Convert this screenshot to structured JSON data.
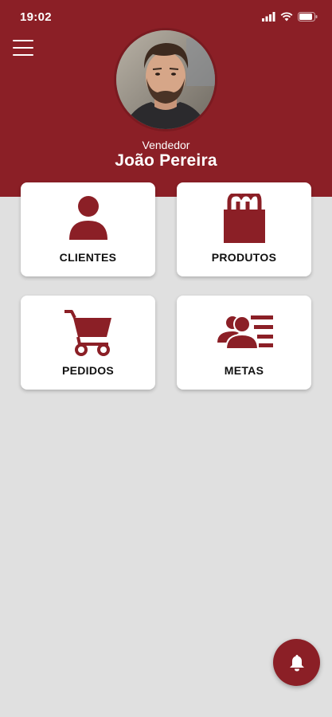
{
  "status_bar": {
    "time": "19:02"
  },
  "profile": {
    "role": "Vendedor",
    "name": "João Pereira"
  },
  "menu": [
    {
      "label": "CLIENTES",
      "icon": "person-icon"
    },
    {
      "label": "PRODUTOS",
      "icon": "shopping-bag-icon"
    },
    {
      "label": "PEDIDOS",
      "icon": "shopping-cart-icon"
    },
    {
      "label": "METAS",
      "icon": "group-list-icon"
    }
  ],
  "colors": {
    "primary": "#8b1f26",
    "background": "#e0e0e0",
    "card": "#ffffff"
  }
}
